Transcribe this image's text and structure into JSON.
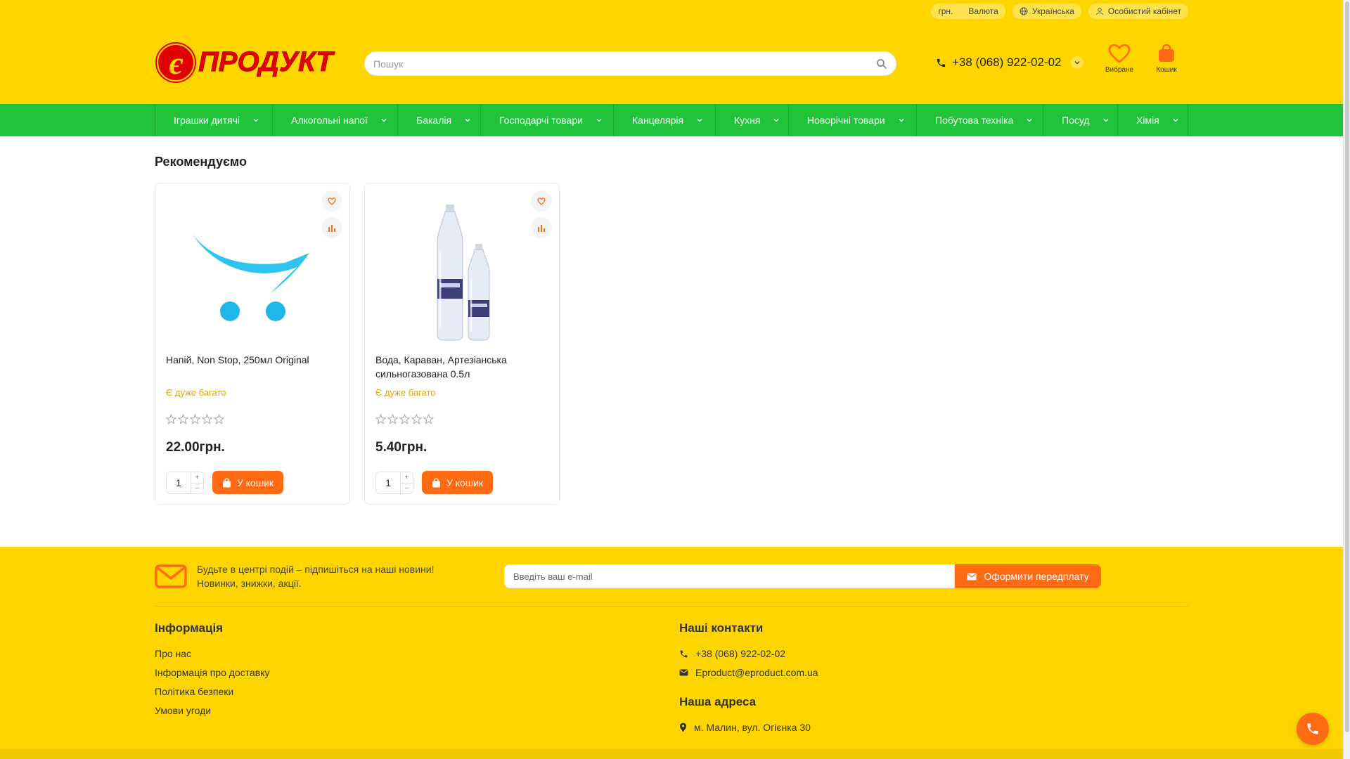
{
  "topbar": {
    "currency_value": "грн.",
    "currency_label": "Валюта",
    "language": "Українська",
    "account": "Особистий кабінет"
  },
  "brand": {
    "logo_text": "Епродукт",
    "logo_color": "#e10000"
  },
  "search": {
    "placeholder": "Пошук"
  },
  "header": {
    "phone": "+38 (068) 922-02-02",
    "wishlist_label": "Вибране",
    "cart_label": "Кошик"
  },
  "nav": {
    "items": [
      {
        "label": "Іграшки дитячі"
      },
      {
        "label": "Алкогольні напої"
      },
      {
        "label": "Бакалія"
      },
      {
        "label": "Господарчі товари"
      },
      {
        "label": "Канцелярія"
      },
      {
        "label": "Кухня"
      },
      {
        "label": "Новорічні товари"
      },
      {
        "label": "Побутова техніка"
      },
      {
        "label": "Посуд"
      },
      {
        "label": "Хімія"
      }
    ]
  },
  "main": {
    "section_title": "Рекомендуємо",
    "products": [
      {
        "name": "Напій, Non Stop, 250мл Original",
        "stock": "Є дуже багато",
        "rating": 0,
        "price": "22.00грн.",
        "qty": "1",
        "button": "У кошик",
        "image": "placeholder-cart-image"
      },
      {
        "name": "Вода, Караван, Артезіанська сильногазована 0.5л",
        "stock": "Є дуже багато",
        "rating": 0,
        "price": "5.40грн.",
        "qty": "1",
        "button": "У кошик",
        "image": "water-bottles-image"
      }
    ]
  },
  "footer": {
    "newsletter_text": "Будьте в центрі подій – підпишіться на наші новини! Новинки, знижки, акції.",
    "email_placeholder": "Введіть ваш e-mail",
    "subscribe_button": "Оформити передплату",
    "info_heading": "Інформація",
    "info_links": [
      "Про нас",
      "Інформація про доставку",
      "Політика безпеки",
      "Умови угоди"
    ],
    "contacts_heading": "Наші контакти",
    "phone": "+38 (068) 922-02-02",
    "email": "Eproduct@eproduct.com.ua",
    "address_heading": "Наша адреса",
    "address": "м. Малин, вул. Огієнка 30"
  },
  "colors": {
    "brand_yellow": "#ffd500",
    "nav_green": "#20c33a",
    "accent_orange": "#ff6a13"
  }
}
